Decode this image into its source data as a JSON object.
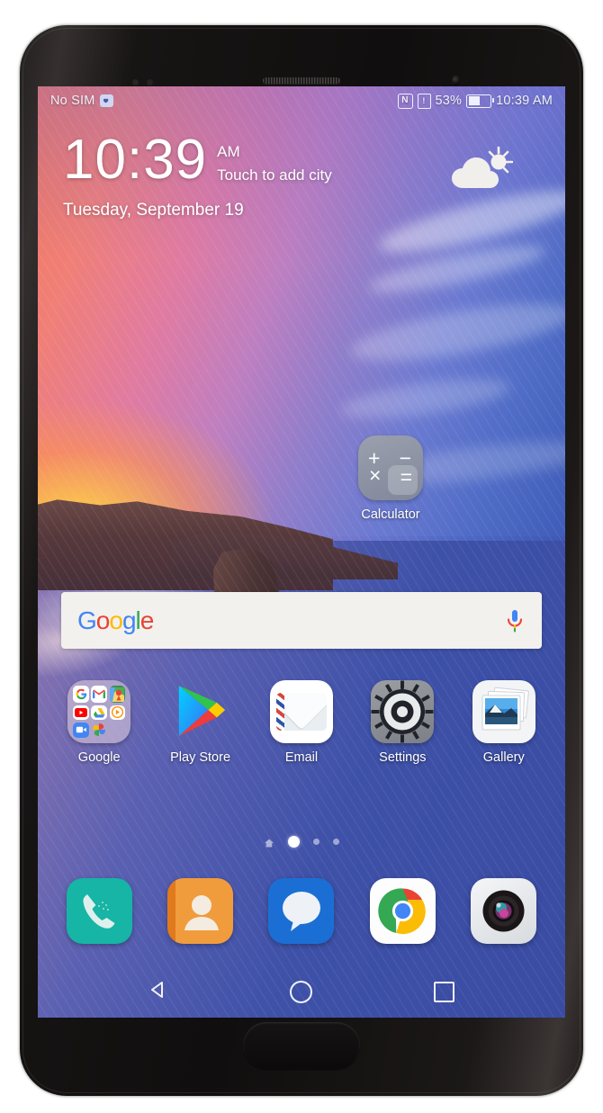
{
  "device": {
    "name": "huawei-mate-10-phone"
  },
  "statusbar": {
    "carrier": "No SIM",
    "sim_icon": "sim-card-icon",
    "nfc_icon": "nfc-icon",
    "nfc_glyph": "N",
    "alert_icon": "alert-icon",
    "alert_glyph": "!",
    "battery_percent": "53%",
    "battery_icon": "battery-icon",
    "battery_level": 50,
    "clock": "10:39 AM"
  },
  "clock_widget": {
    "time": "10:39",
    "ampm": "AM",
    "city_prompt": "Touch to add city",
    "date": "Tuesday, September 19",
    "weather_icon": "partly-cloudy-icon"
  },
  "shortcut": {
    "calculator": {
      "label": "Calculator",
      "icon": "calculator-icon",
      "symbols": {
        "plus": "+",
        "minus": "−",
        "times": "×",
        "equals": "="
      }
    }
  },
  "search": {
    "logo": "google-logo",
    "logo_letters": [
      {
        "char": "G",
        "color": "#4285f4"
      },
      {
        "char": "o",
        "color": "#ea4335"
      },
      {
        "char": "o",
        "color": "#fbbc05"
      },
      {
        "char": "g",
        "color": "#4285f4"
      },
      {
        "char": "l",
        "color": "#34a853"
      },
      {
        "char": "e",
        "color": "#ea4335"
      }
    ],
    "mic_icon": "microphone-icon",
    "value": "",
    "placeholder": ""
  },
  "apps": [
    {
      "label": "Google",
      "icon": "google-folder-icon",
      "folder_apps": [
        "google-search-icon",
        "gmail-icon",
        "maps-icon",
        "youtube-icon",
        "drive-icon",
        "play-music-icon",
        "duo-icon",
        "photos-icon"
      ]
    },
    {
      "label": "Play Store",
      "icon": "play-store-icon"
    },
    {
      "label": "Email",
      "icon": "email-icon"
    },
    {
      "label": "Settings",
      "icon": "settings-gear-icon"
    },
    {
      "label": "Gallery",
      "icon": "gallery-icon"
    }
  ],
  "page_indicator": {
    "count": 4,
    "active_index": 1,
    "home_index": 0
  },
  "dock": [
    {
      "label": "Phone",
      "icon": "phone-icon",
      "color": "#16b5a5"
    },
    {
      "label": "Contacts",
      "icon": "contacts-icon",
      "color": "#ee9328"
    },
    {
      "label": "Messages",
      "icon": "messages-icon",
      "color": "#1b6fd4"
    },
    {
      "label": "Chrome",
      "icon": "chrome-icon",
      "color": "#ffffff"
    },
    {
      "label": "Camera",
      "icon": "camera-icon",
      "color": "#e9ecef"
    }
  ],
  "navbar": [
    {
      "label": "Back",
      "icon": "back-triangle-icon"
    },
    {
      "label": "Home",
      "icon": "home-circle-icon"
    },
    {
      "label": "Recents",
      "icon": "recents-square-icon"
    }
  ],
  "colors": {
    "status_text": "#eef1fb",
    "accent_blue": "#4285f4",
    "accent_red": "#ea4335",
    "accent_yellow": "#fbbc05",
    "accent_green": "#34a853"
  }
}
